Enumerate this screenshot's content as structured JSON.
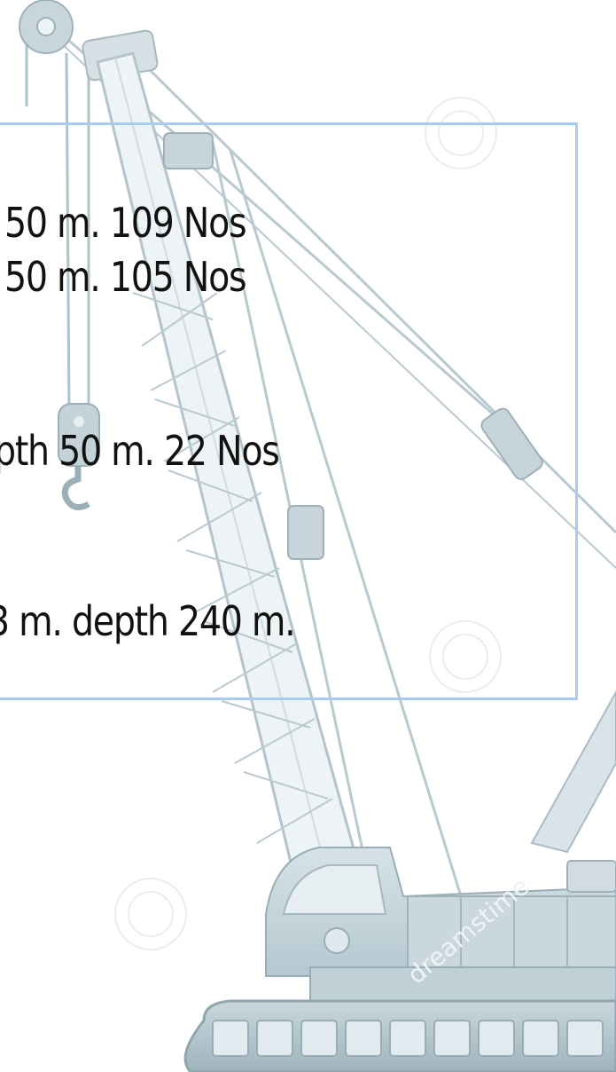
{
  "lines": [
    "50 m. 109 Nos",
    "50 m. 105 Nos",
    "pth 50 m. 22 Nos",
    "3 m. depth 240 m."
  ],
  "watermark": "dreamstime",
  "colors": {
    "frame_border": "#a9cbee",
    "crane_light": "#e3edf1",
    "crane_mid": "#c2d3da",
    "crane_dark": "#8fa6af",
    "text": "#111111"
  },
  "icons": {
    "crane": "crawler-crane-illustration",
    "hook": "crane-hook-icon"
  }
}
